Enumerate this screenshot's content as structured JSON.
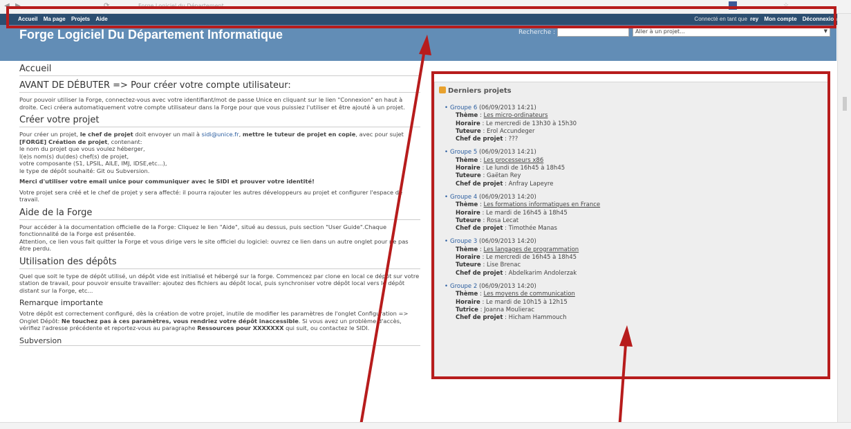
{
  "browser": {
    "tab_title": "Forge Logiciel du Département"
  },
  "topbar": {
    "menu": [
      "Accueil",
      "Ma page",
      "Projets",
      "Aide"
    ],
    "connected_text": "Connecté en tant que",
    "username": "rey",
    "my_account": "Mon compte",
    "logout": "Déconnexion"
  },
  "header": {
    "title": "Forge Logiciel Du Département Informatique",
    "search_label": "Recherche :",
    "project_select": "Aller à un projet..."
  },
  "main": {
    "page_heading": "Accueil",
    "s1_heading": "AVANT DE DÉBUTER => Pour créer votre compte utilisateur:",
    "s1_p1": "Pour pouvoir utiliser la Forge, connectez-vous avec votre identifiant/mot de passe Unice en cliquant sur le lien \"Connexion\" en haut à droite. Ceci créera automatiquement votre compte utilisateur dans la Forge pour que vous puissiez l'utiliser et être ajouté à un projet.",
    "s2_heading": "Créer votre projet",
    "s2_p1_a": "Pour créer un projet, ",
    "s2_p1_b": "le chef de projet",
    "s2_p1_c": " doit envoyer un mail à ",
    "s2_email": "sidi@unice.fr",
    "s2_p1_d": ", ",
    "s2_p1_e": "mettre le tuteur de projet en copie",
    "s2_p1_f": ", avec pour sujet ",
    "s2_p1_g": "[FORGE] Création de projet",
    "s2_p1_h": ", contenant:",
    "s2_lines": [
      "le nom du projet que vous voulez héberger,",
      "l(e)s nom(s) du(des) chef(s) de projet,",
      "votre composante (S1, LPSIL, AILE, IMJ, IDSE,etc...),",
      "le type de dépôt souhaité: Git ou Subversion."
    ],
    "s2_bold": "Merci d'utiliser votre email unice pour communiquer avec le SIDI et prouver votre identité!",
    "s2_p3": "Votre projet sera créé et le chef de projet y sera affecté: il pourra rajouter les autres développeurs au projet et configurer l'espace de travail.",
    "s3_heading": "Aide de la Forge",
    "s3_p1": "Pour accéder à la documentation officielle de la Forge: Cliquez le lien \"Aide\", situé au dessus, puis section \"User Guide\".Chaque fonctionnalité de la Forge est présentée.",
    "s3_p2": "Attention, ce lien vous fait quitter la Forge et vous dirige vers le site officiel du logiciel: ouvrez ce lien dans un autre onglet pour ne pas être perdu.",
    "s4_heading": "Utilisation des dépôts",
    "s4_p1": "Quel que soit le type de dépôt utilisé, un dépôt vide est initialisé et hébergé sur la forge. Commencez par clone en local ce dépôt sur votre station de travail, pour pouvoir ensuite travailler: ajoutez des fichiers au dépôt local, puis synchroniser votre dépôt local vers le dépôt distant sur la Forge, etc...",
    "s5_heading": "Remarque importante",
    "s5_p1_a": "Votre dépôt est correctement configuré, dès la création de votre projet, inutile de modifier les paramètres de l'onglet Configuration => Onglet Dépôt: ",
    "s5_p1_b": "Ne touchez pas à ces paramètres, vous rendriez votre dépôt inaccessible",
    "s5_p1_c": ". Si vous avez un problème d'accès, vérifiez l'adresse précédente et reportez-vous au paragraphe ",
    "s5_p1_d": "Ressources pour XXXXXXX",
    "s5_p1_e": " qui suit, ou contactez le SIDI.",
    "s6_heading": "Subversion"
  },
  "sidebar": {
    "title": "Derniers projets",
    "labels": {
      "theme": "Thème",
      "horaire": "Horaire",
      "chef": "Chef de projet"
    },
    "projects": [
      {
        "name": "Groupe 6",
        "date": "(06/09/2013 14:21)",
        "theme": "Les micro-ordinateurs",
        "horaire": "Le mercredi de 13h30 à 15h30",
        "tutor_label": "Tuteure",
        "tutor": "Erol Accundeger",
        "chef": "???"
      },
      {
        "name": "Groupe 5",
        "date": "(06/09/2013 14:21)",
        "theme": "Les processeurs x86",
        "horaire": "Le lundi de 16h45 à 18h45",
        "tutor_label": "Tuteure",
        "tutor": "Gaëtan Rey",
        "chef": "Anfray Lapeyre"
      },
      {
        "name": "Groupe 4",
        "date": "(06/09/2013 14:20)",
        "theme": "Les formations informatiques en France",
        "horaire": "Le mardi de 16h45 à 18h45",
        "tutor_label": "Tuteure",
        "tutor": "Rosa Lecat",
        "chef": "Timothée Manas"
      },
      {
        "name": "Groupe 3",
        "date": "(06/09/2013 14:20)",
        "theme": "Les langages de programmation",
        "horaire": "Le mercredi de 16h45 à 18h45",
        "tutor_label": "Tuteure",
        "tutor": "Lise Brenac",
        "chef": "Abdelkarim Andolerzak"
      },
      {
        "name": "Groupe 2",
        "date": "(06/09/2013 14:20)",
        "theme": "Les moyens de communication",
        "horaire": "Le mardi de 10h15 à 12h15",
        "tutor_label": "Tutrice",
        "tutor": "Joanna Moulierac",
        "chef": "Hicham Hammouch"
      }
    ]
  },
  "colors": {
    "topbar": "#2c4e70",
    "header": "#628db6",
    "annotation": "#b71c1c",
    "link": "#2a5d9f"
  }
}
